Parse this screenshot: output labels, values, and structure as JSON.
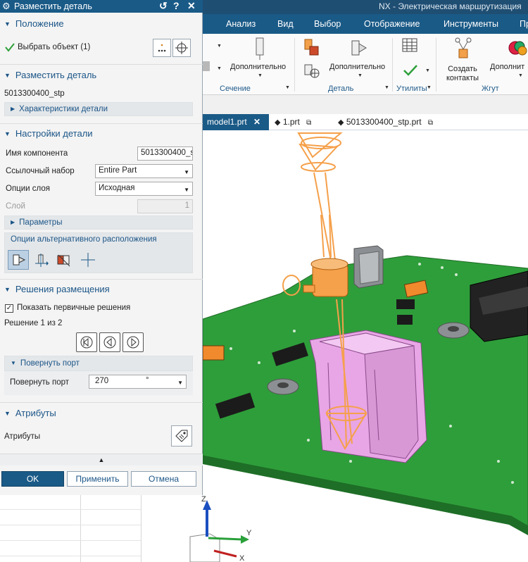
{
  "app": {
    "title": "NX - Электрическая маршрутизация",
    "menu": [
      "Анализ",
      "Вид",
      "Выбор",
      "Отображение",
      "Инструменты",
      "Пр"
    ]
  },
  "ribbon": {
    "more_label_1": "Дополнительно",
    "more_label_2": "Дополнительно",
    "more_label_3": "Дополнит",
    "create_contacts": [
      "Создать",
      "контакты"
    ],
    "groups": [
      "Сечение",
      "Деталь",
      "Утилиты",
      "Жгут"
    ]
  },
  "tabs": [
    {
      "label": "model1.prt",
      "active": true
    },
    {
      "label": "1.prt",
      "active": false
    },
    {
      "label": "5013300400_stp.prt",
      "active": false
    }
  ],
  "dialog": {
    "title": "Разместить деталь",
    "position": {
      "header": "Положение",
      "select_object": "Выбрать объект (1)"
    },
    "place_part": {
      "header": "Разместить деталь",
      "part_name": "5013300400_stp",
      "characteristics": "Характеристики детали"
    },
    "part_settings": {
      "header": "Настройки детали",
      "component_name_label": "Имя компонента",
      "component_name_value": "5013300400_s",
      "reference_set_label": "Ссылочный набор",
      "reference_set_value": "Entire Part",
      "layer_options_label": "Опции слоя",
      "layer_options_value": "Исходная",
      "layer_label": "Слой",
      "layer_value": "1",
      "parameters": "Параметры",
      "alt_placement": "Опции альтернативного расположения"
    },
    "placement_solutions": {
      "header": "Решения размещения",
      "show_primary": "Показать первичные решения",
      "show_primary_checked": true,
      "solution_counter": "Решение 1 из 2",
      "rotate_port_header": "Повернуть порт",
      "rotate_port_label": "Повернуть порт",
      "rotate_port_value": "270",
      "rotate_port_unit": "°"
    },
    "attributes": {
      "header": "Атрибуты",
      "label": "Атрибуты"
    },
    "buttons": {
      "ok": "OK",
      "apply": "Применить",
      "cancel": "Отмена"
    }
  },
  "triad": {
    "z": "Z",
    "y": "Y",
    "x": "X"
  },
  "colors": {
    "brand_blue": "#1a5a87",
    "pcb_green": "#2e9e3a",
    "connector_pink": "#e8a6e6",
    "highlight_orange": "#f5a04a"
  }
}
